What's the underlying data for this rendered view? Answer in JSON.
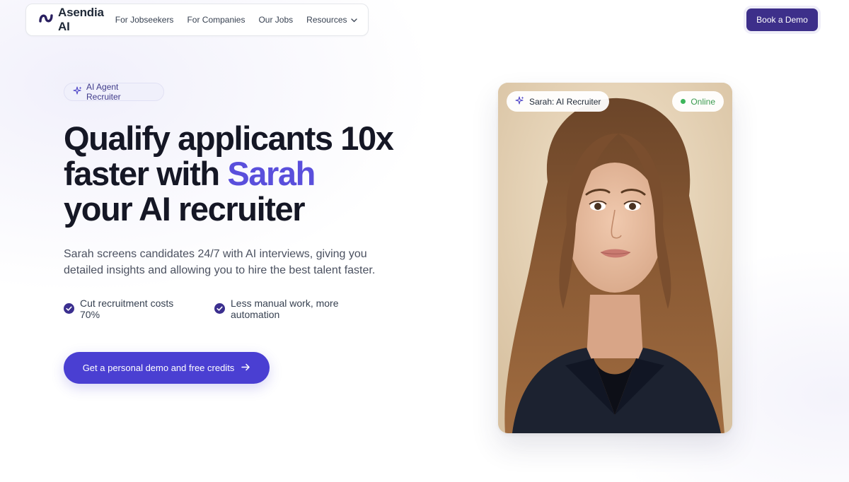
{
  "nav": {
    "logo_text": "Asendia AI",
    "links": [
      "For Jobseekers",
      "For Companies",
      "Our Jobs",
      "Resources"
    ],
    "book_demo_label": "Book a Demo"
  },
  "hero": {
    "badge_label": "AI Agent Recruiter",
    "headline_line1": "Qualify applicants 10x",
    "headline_line2_prefix": "faster with ",
    "headline_line2_accent": "Sarah",
    "headline_line3": "your AI recruiter",
    "subtitle": "Sarah screens candidates 24/7 with AI interviews, giving you detailed insights and allowing you to hire the best talent faster.",
    "features": [
      "Cut recruitment costs 70%",
      "Less manual work, more automation"
    ],
    "cta_label": "Get a personal demo and free credits"
  },
  "card": {
    "name_label": "Sarah: AI Recruiter",
    "status_label": "Online"
  },
  "colors": {
    "accent": "#5a4fdc",
    "primary_button": "#4a3fd2",
    "book_button": "#3d2f8a",
    "online": "#3cb55a"
  },
  "icons": [
    "asendia-logo-icon",
    "chevron-down-icon",
    "sparkle-icon",
    "check-circle-icon",
    "arrow-right-icon",
    "status-dot-icon"
  ]
}
